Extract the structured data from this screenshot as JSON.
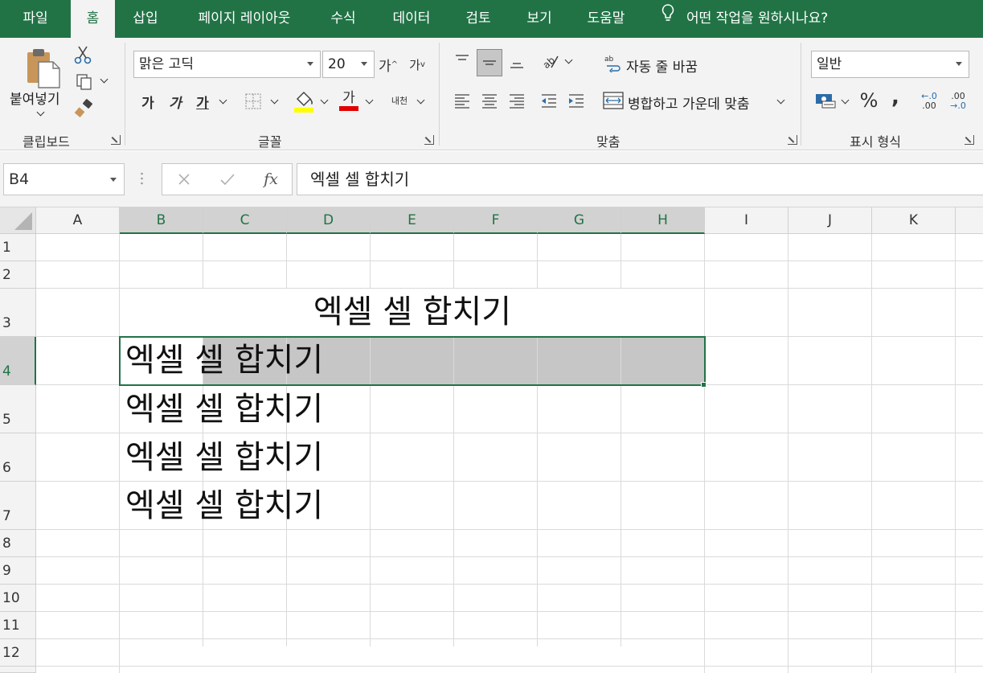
{
  "colors": {
    "accent": "#217346",
    "selection": "#c6c6c6"
  },
  "tabs": [
    {
      "label": "파일",
      "active": false
    },
    {
      "label": "홈",
      "active": true
    },
    {
      "label": "삽입",
      "active": false
    },
    {
      "label": "페이지 레이아웃",
      "active": false
    },
    {
      "label": "수식",
      "active": false
    },
    {
      "label": "데이터",
      "active": false
    },
    {
      "label": "검토",
      "active": false
    },
    {
      "label": "보기",
      "active": false
    },
    {
      "label": "도움말",
      "active": false
    }
  ],
  "tell_me": "어떤 작업을 원하시나요?",
  "clipboard": {
    "paste_label": "붙여넣기",
    "group_label": "클립보드"
  },
  "font": {
    "name": "맑은 고딕",
    "size": "20",
    "wrap_label": "내천",
    "group_label": "글꼴"
  },
  "alignment": {
    "wrap_text": "자동 줄 바꿈",
    "merge_center": "병합하고 가운데 맞춤",
    "group_label": "맞춤"
  },
  "number": {
    "format": "일반",
    "group_label": "표시 형식",
    "percent": "%",
    "comma": ",",
    "inc_decimal": ".00",
    "dec_decimal": ".0"
  },
  "formula_bar": {
    "name_box": "B4",
    "fx": "fx",
    "content": "엑셀 셀 합치기"
  },
  "columns": [
    "A",
    "B",
    "C",
    "D",
    "E",
    "F",
    "G",
    "H",
    "I",
    "J",
    "K"
  ],
  "rows": [
    "1",
    "2",
    "3",
    "4",
    "5",
    "6",
    "7",
    "8",
    "9",
    "10",
    "11",
    "12"
  ],
  "cells": {
    "r3": "엑셀 셀 합치기",
    "r4": "엑셀 셀 합치기",
    "r5": "엑셀 셀 합치기",
    "r6": "엑셀 셀 합치기",
    "r7": "엑셀 셀 합치기"
  }
}
